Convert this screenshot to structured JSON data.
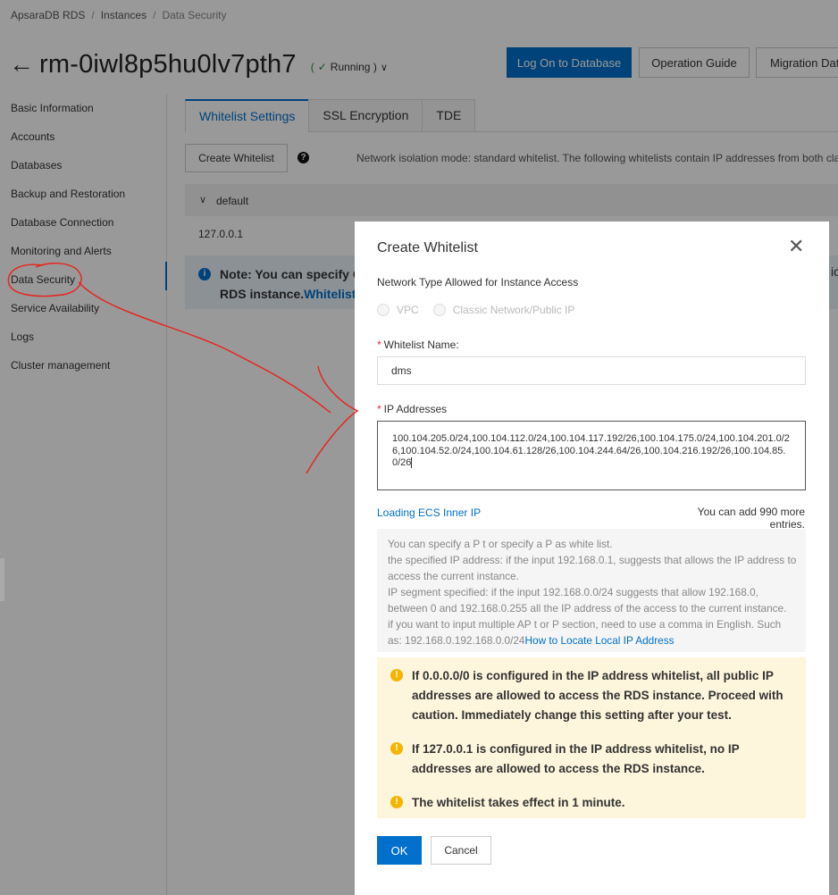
{
  "breadcrumb": {
    "items": [
      "ApsaraDB RDS",
      "Instances",
      "Data Security"
    ]
  },
  "header": {
    "instance_id": "rm-0iwl8p5hu0lv7pth7",
    "status": "Running )",
    "buttons": {
      "logon": "Log On to Database",
      "guide": "Operation Guide",
      "migrate": "Migration Data"
    }
  },
  "sidebar": {
    "items": [
      {
        "label": "Basic Information"
      },
      {
        "label": "Accounts"
      },
      {
        "label": "Databases"
      },
      {
        "label": "Backup and Restoration"
      },
      {
        "label": "Database Connection"
      },
      {
        "label": "Monitoring and Alerts"
      },
      {
        "label": "Data Security"
      },
      {
        "label": "Service Availability"
      },
      {
        "label": "Logs"
      },
      {
        "label": "Cluster management"
      }
    ]
  },
  "tabs": [
    {
      "label": "Whitelist Settings"
    },
    {
      "label": "SSL Encryption"
    },
    {
      "label": "TDE"
    }
  ],
  "main": {
    "create_whitelist": "Create Whitelist",
    "mode_text": "Network isolation mode: standard whitelist. The following whitelists contain IP addresses from both cla",
    "group_name": "default",
    "group_ip": "127.0.0.1",
    "note_line1": "Note: You can specify Cl",
    "note_line2": "RDS instance.",
    "note_link": "Whitelist S",
    "note_right": "ica"
  },
  "modal": {
    "title": "Create Whitelist",
    "network_label": "Network Type Allowed for Instance Access",
    "radio_vpc": "VPC",
    "radio_classic": "Classic Network/Public IP",
    "name_label": "Whitelist Name:",
    "name_value": "dms",
    "ip_label": "IP Addresses",
    "ip_value": "100.104.205.0/24,100.104.112.0/24,100.104.117.192/26,100.104.175.0/24,100.104.201.0/26,100.104.52.0/24,100.104.61.128/26,100.104.244.64/26,100.104.216.192/26,100.104.85.0/26",
    "loading_link": "Loading ECS Inner IP",
    "remaining": "You can add 990 more entries.",
    "help_line1": "You can specify a P t or specify a P as white list.",
    "help_line2": "the specified IP address: if the input 192.168.0.1, suggests that allows the IP address to access the current instance.",
    "help_line3": "IP segment specified: if the input 192.168.0.0/24 suggests that allow 192.168.0, between 0 and 192.168.0.255 all the IP address of the access to the current instance.",
    "help_line4": "if you want to input multiple AP t or P section, need to use a comma in English. Such as: 192.168.0.192.168.0.0/24",
    "help_link": "How to Locate Local IP Address",
    "warn1": "If 0.0.0.0/0 is configured in the IP address whitelist, all public IP addresses are allowed to access the RDS instance. Proceed with caution. Immediately change this setting after your test.",
    "warn2": "If 127.0.0.1 is configured in the IP address whitelist, no IP addresses are allowed to access the RDS instance.",
    "warn3": "The whitelist takes effect in 1 minute.",
    "ok": "OK",
    "cancel": "Cancel"
  },
  "colors": {
    "accent": "#0070cc",
    "warning": "#f4b400",
    "annotation": "#e8221b"
  }
}
